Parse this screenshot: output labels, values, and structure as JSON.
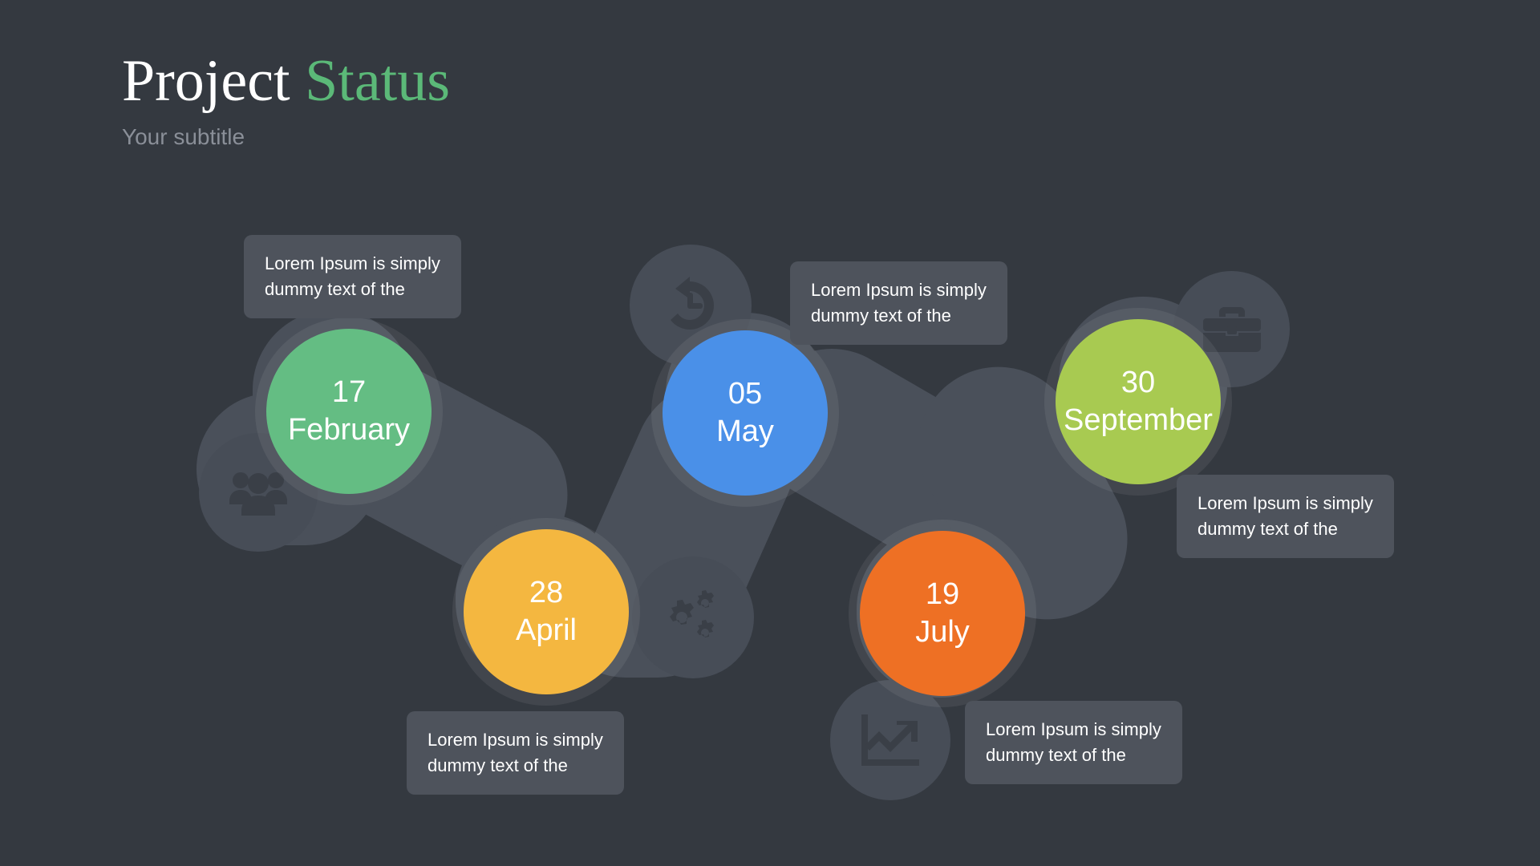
{
  "header": {
    "title_main": "Project",
    "title_accent": "Status",
    "subtitle": "Your subtitle"
  },
  "colors": {
    "background": "#343940",
    "accent_green": "#5bb978",
    "node_february": "#64bd83",
    "node_april": "#f4b740",
    "node_may": "#4a90e8",
    "node_july": "#ee7024",
    "node_september": "#a8ca51",
    "caption_bg": "#4e535c",
    "bubble_bg": "#474d57",
    "icon_fill": "#3a3f47",
    "subtitle_text": "#8a8f98"
  },
  "milestones": [
    {
      "id": "february",
      "day": "17",
      "month": "February",
      "color": "#64bd83",
      "caption": [
        "Lorem Ipsum is simply",
        "dummy text of the"
      ]
    },
    {
      "id": "april",
      "day": "28",
      "month": "April",
      "color": "#f4b740",
      "caption": [
        "Lorem Ipsum is simply",
        "dummy text of the"
      ]
    },
    {
      "id": "may",
      "day": "05",
      "month": "May",
      "color": "#4a90e8",
      "caption": [
        "Lorem Ipsum is simply",
        "dummy text of the"
      ]
    },
    {
      "id": "july",
      "day": "19",
      "month": "July",
      "color": "#ee7024",
      "caption": [
        "Lorem Ipsum is simply",
        "dummy text of the"
      ]
    },
    {
      "id": "september",
      "day": "30",
      "month": "September",
      "color": "#a8ca51",
      "caption": [
        "Lorem Ipsum is simply",
        "dummy text of the"
      ]
    }
  ],
  "icons": [
    {
      "id": "users",
      "name": "users-group-icon"
    },
    {
      "id": "history",
      "name": "history-clock-icon"
    },
    {
      "id": "briefcase",
      "name": "briefcase-icon"
    },
    {
      "id": "gears",
      "name": "gears-cogs-icon"
    },
    {
      "id": "growth-chart",
      "name": "growth-chart-icon"
    }
  ]
}
